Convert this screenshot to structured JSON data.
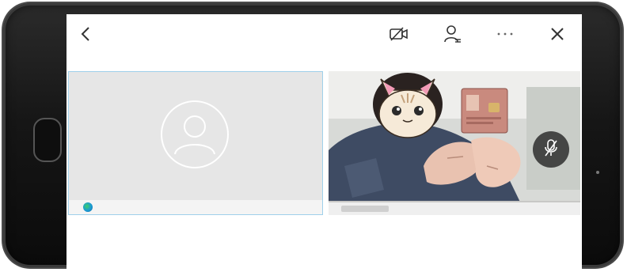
{
  "topbar": {
    "icons": {
      "back": "chevron-left-icon",
      "camera_off": "camera-off-icon",
      "participants": "person-list-icon",
      "more": "more-horizontal-icon",
      "close": "close-icon"
    }
  },
  "tiles": [
    {
      "type": "avatar-placeholder",
      "icon": "person-avatar-icon",
      "status_icon": "status-dot-icon",
      "selected": true
    },
    {
      "type": "video",
      "overlay_icon": "mic-off-icon",
      "content": "camera-feed"
    }
  ],
  "colors": {
    "tile_border_selected": "#9fd0ea",
    "tile_bg": "#e6e6e6",
    "icon_color": "#333333",
    "mic_off_bg": "#282828"
  }
}
